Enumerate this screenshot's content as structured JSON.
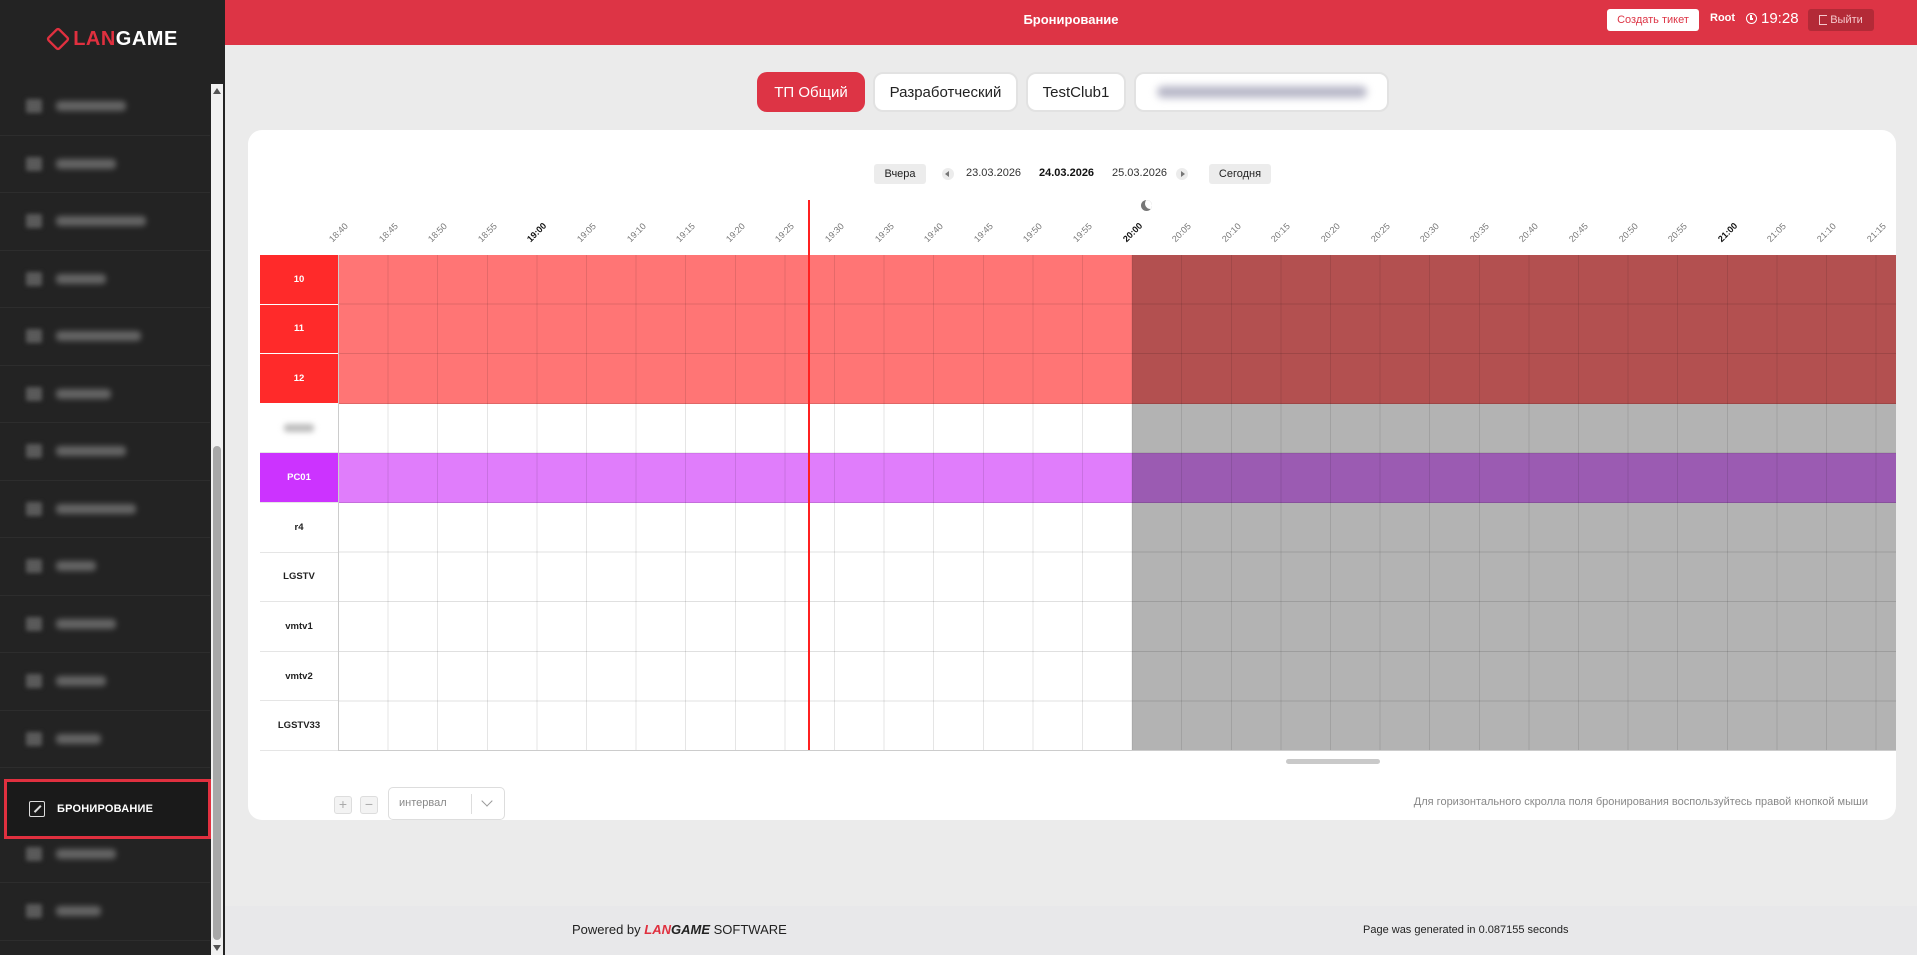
{
  "sidebar": {
    "logo": {
      "part1": "LAN",
      "part2": "GAME"
    },
    "active_item": "БРОНИРОВАНИЕ",
    "blurred_widths": [
      70,
      60,
      90,
      50,
      85,
      55,
      70,
      80,
      40,
      60,
      50,
      45,
      0,
      60,
      45
    ]
  },
  "header": {
    "title": "Бронирование",
    "create_ticket": "Создать тикет",
    "user": "Root",
    "time": "19:28",
    "logout": "Выйти"
  },
  "clubs": {
    "tabs": [
      "ТП Общий",
      "Разработчеcкий",
      "TestClub1"
    ],
    "active": 0
  },
  "date_nav": {
    "yesterday": "Вчера",
    "prev_date": "23.03.2026",
    "current_date": "24.03.2026",
    "next_date": "25.03.2026",
    "today": "Сегодня"
  },
  "timeline": {
    "times": [
      "18:40",
      "18:45",
      "18:50",
      "18:55",
      "19:00",
      "19:05",
      "19:10",
      "19:15",
      "19:20",
      "19:25",
      "19:30",
      "19:35",
      "19:40",
      "19:45",
      "19:50",
      "19:55",
      "20:00",
      "20:05",
      "20:10",
      "20:15",
      "20:20",
      "20:25",
      "20:30",
      "20:35",
      "20:40",
      "20:45",
      "20:50",
      "20:55",
      "21:00",
      "21:05",
      "21:10",
      "21:15"
    ],
    "major": [
      "19:00",
      "20:00",
      "21:00"
    ]
  },
  "rows": [
    {
      "label": "10",
      "style": "red"
    },
    {
      "label": "11",
      "style": "red"
    },
    {
      "label": "12",
      "style": "red"
    },
    {
      "label": "",
      "style": "blurred"
    },
    {
      "label": "PC01",
      "style": "purple"
    },
    {
      "label": "r4",
      "style": "normal"
    },
    {
      "label": "LGSTV",
      "style": "normal"
    },
    {
      "label": "vmtv1",
      "style": "normal"
    },
    {
      "label": "vmtv2",
      "style": "normal"
    },
    {
      "label": "LGSTV33",
      "style": "normal"
    }
  ],
  "colors": {
    "accent": "#dd3445",
    "red_past": "#ff7575",
    "red_future": "#b35050",
    "purple_past": "#e07dfb",
    "purple_future": "#9b5bb2",
    "future_gray": "#b3b3b3"
  },
  "controls": {
    "zoom_in": "+",
    "zoom_out": "−",
    "interval_placeholder": "интервал",
    "hint": "Для горизонтального скролла поля бронирования воспользуйтесь правой кнопкой мыши"
  },
  "footer": {
    "powered_prefix": "Powered by",
    "brand_part1": "LAN",
    "brand_part2": "GAME",
    "brand_suffix": "SOFTWARE",
    "generated": "Page was generated in 0.087155 seconds"
  }
}
